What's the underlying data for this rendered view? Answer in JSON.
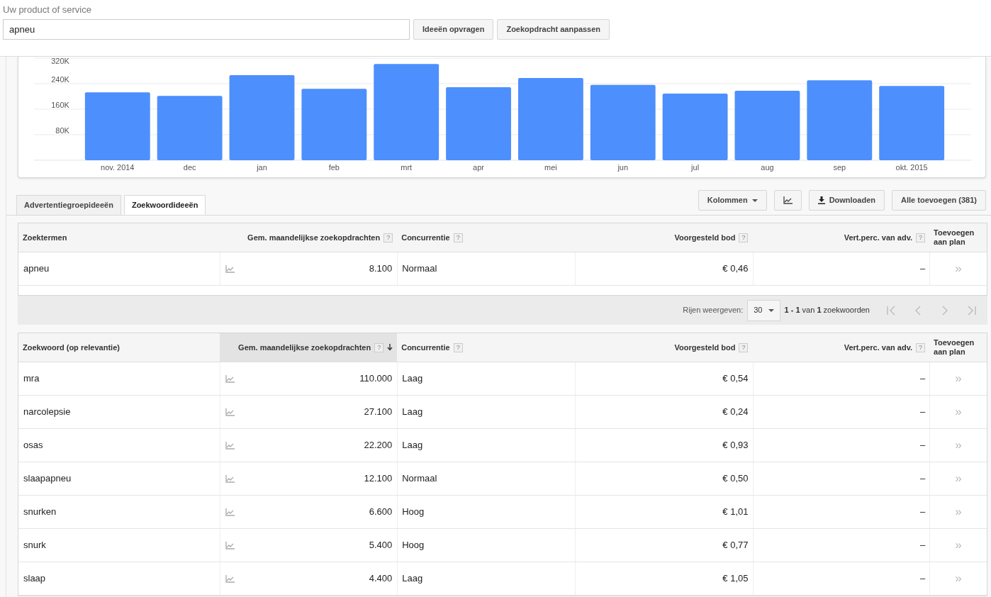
{
  "search": {
    "label": "Uw product of service",
    "value": "apneu"
  },
  "search_buttons": [
    "Ideeën opvragen",
    "Zoekopdracht aanpassen"
  ],
  "chart_data": {
    "type": "bar",
    "categories": [
      "nov. 2014",
      "dec",
      "jan",
      "feb",
      "mrt",
      "apr",
      "mei",
      "jun",
      "jul",
      "aug",
      "sep",
      "okt. 2015"
    ],
    "grid": true,
    "series": [
      {
        "color": "#4d8ffd",
        "values": [
          213000,
          202000,
          267000,
          224000,
          302000,
          229000,
          258000,
          236000,
          209000,
          218000,
          251000,
          233000
        ]
      }
    ],
    "ylim": [
      0,
      320000
    ],
    "yticks": [
      {
        "value": 80000,
        "label": "80K"
      },
      {
        "value": 160000,
        "label": "160K"
      },
      {
        "value": 240000,
        "label": "240K"
      },
      {
        "value": 320000,
        "label": "320K"
      }
    ]
  },
  "tabs": [
    {
      "label": "Advertentiegroepideeën",
      "selected": false
    },
    {
      "label": "Zoekwoordideeën",
      "selected": true
    }
  ],
  "toolbar": [
    {
      "kind": "dropdown",
      "label": "Kolommen"
    },
    {
      "kind": "chart"
    },
    {
      "kind": "download",
      "label": "Downloaden"
    },
    {
      "kind": "plain",
      "label": "Alle toevoegen (381)"
    }
  ],
  "search_terms_table": {
    "columns": [
      {
        "label": "Zoektermen",
        "sorted": false
      },
      {
        "label": "Gem. maandelijkse zoekopdrachten",
        "help": "?",
        "sorted": false
      },
      {
        "label": "Concurrentie",
        "help": "?",
        "sorted": false
      },
      {
        "label": "Voorgesteld bod",
        "help": "?",
        "sorted": false
      },
      {
        "label": "Vert.perc. van adv.",
        "help": "?",
        "sorted": false
      },
      {
        "label": "Toevoegen aan plan",
        "sorted": false
      }
    ],
    "rows": [
      {
        "keyword": "apneu",
        "searches": "8.100",
        "competition": "Normaal",
        "bid": "€ 0,46",
        "share": "–",
        "add": "»"
      }
    ]
  },
  "pagination": {
    "label": "Rijen weergeven:",
    "rows_per_page": "30",
    "range": "**1 - 1** van **1** zoekwoorden"
  },
  "keyword_ideas_table": {
    "columns": [
      {
        "label": "Zoekwoord (op relevantie)",
        "sorted": false
      },
      {
        "label": "Gem. maandelijkse zoekopdrachten",
        "help": "?",
        "sorted": true
      },
      {
        "label": "Concurrentie",
        "help": "?",
        "sorted": false
      },
      {
        "label": "Voorgesteld bod",
        "help": "?",
        "sorted": false
      },
      {
        "label": "Vert.perc. van adv.",
        "help": "?",
        "sorted": false
      },
      {
        "label": "Toevoegen aan plan",
        "sorted": false
      }
    ],
    "rows": [
      {
        "keyword": "mra",
        "searches": "110.000",
        "competition": "Laag",
        "bid": "€ 0,54",
        "share": "–",
        "add": "»"
      },
      {
        "keyword": "narcolepsie",
        "searches": "27.100",
        "competition": "Laag",
        "bid": "€ 0,24",
        "share": "–",
        "add": "»"
      },
      {
        "keyword": "osas",
        "searches": "22.200",
        "competition": "Laag",
        "bid": "€ 0,93",
        "share": "–",
        "add": "»"
      },
      {
        "keyword": "slaapapneu",
        "searches": "12.100",
        "competition": "Normaal",
        "bid": "€ 0,50",
        "share": "–",
        "add": "»"
      },
      {
        "keyword": "snurken",
        "searches": "6.600",
        "competition": "Hoog",
        "bid": "€ 1,01",
        "share": "–",
        "add": "»"
      },
      {
        "keyword": "snurk",
        "searches": "5.400",
        "competition": "Hoog",
        "bid": "€ 0,77",
        "share": "–",
        "add": "»"
      },
      {
        "keyword": "slaap",
        "searches": "4.400",
        "competition": "Laag",
        "bid": "€ 1,05",
        "share": "–",
        "add": "»"
      }
    ]
  }
}
